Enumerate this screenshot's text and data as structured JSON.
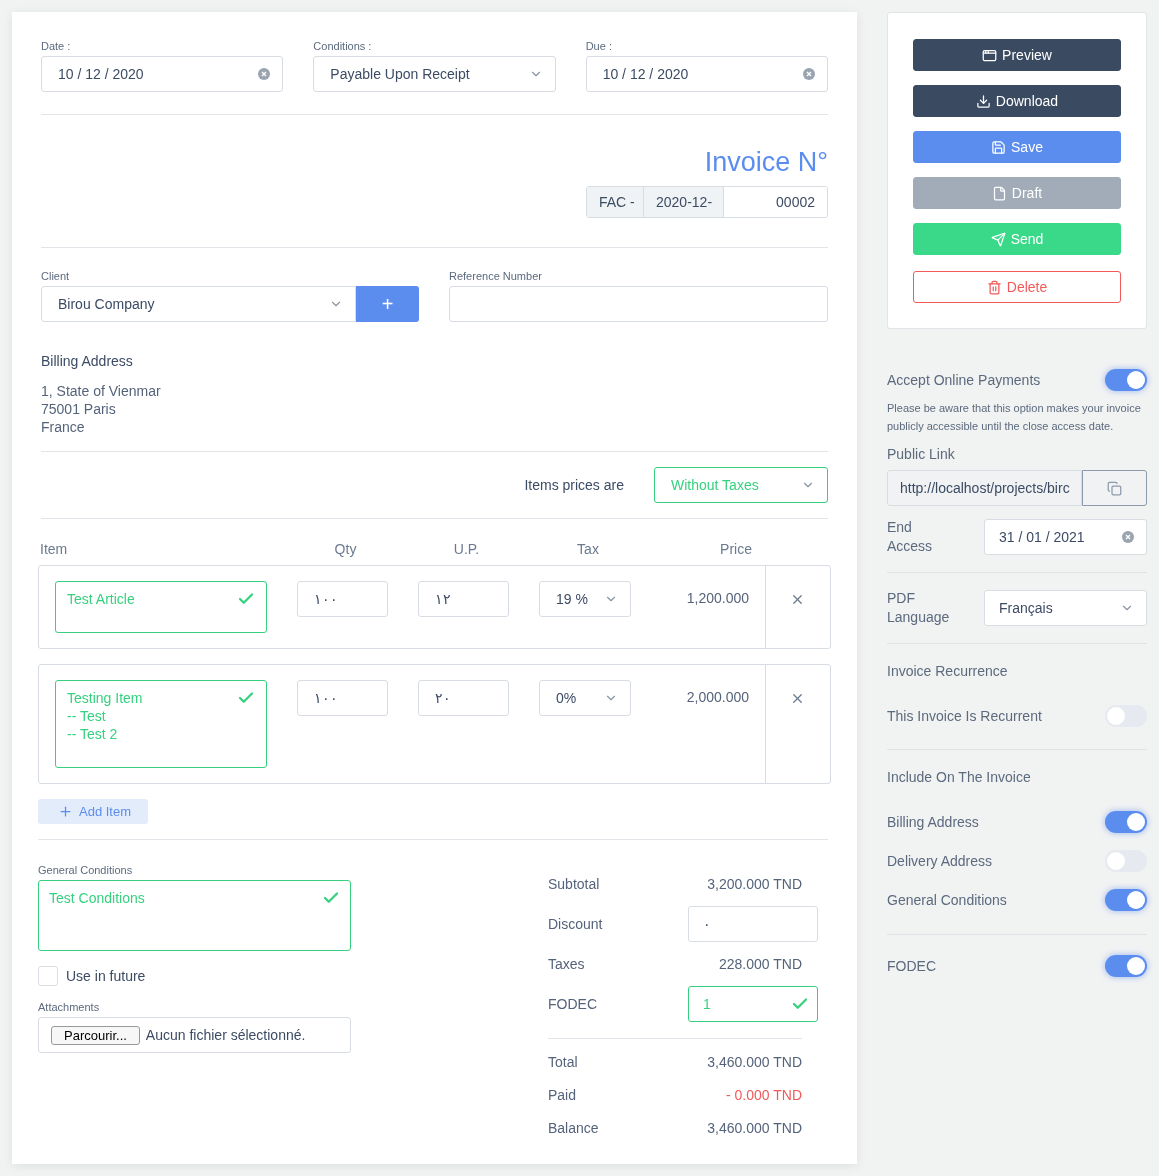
{
  "header_fields": [
    {
      "label": "Date :",
      "value": "10 / 12 / 2020",
      "kind": "date"
    },
    {
      "label": "Conditions :",
      "value": "Payable Upon Receipt",
      "kind": "select"
    },
    {
      "label": "Due :",
      "value": "10 / 12 / 2020",
      "kind": "date"
    }
  ],
  "invoice_number": {
    "title": "Invoice N°",
    "prefix": "FAC -",
    "period": "2020-12-",
    "number": "00002"
  },
  "client": {
    "label": "Client",
    "value": "Birou Company",
    "add_button": "+"
  },
  "reference": {
    "label": "Reference Number"
  },
  "billing_address": {
    "title": "Billing Address",
    "lines": [
      "1, State of Vienmar",
      "75001 Paris",
      "France"
    ]
  },
  "prices": {
    "label": "Items prices are",
    "value": "Without Taxes"
  },
  "columns": [
    "Item",
    "Qty",
    "U.P.",
    "Tax",
    "Price"
  ],
  "items": [
    {
      "lines": [
        "Test Article"
      ],
      "valid": true,
      "qty": "١٠٠",
      "unit_price": "١٢",
      "tax": "19 %",
      "price": "1,200.000"
    },
    {
      "lines": [
        "Testing Item",
        "-- Test",
        "-- Test 2"
      ],
      "valid": true,
      "qty": "١٠٠",
      "unit_price": "٢٠",
      "tax": "0%",
      "price": "2,000.000"
    }
  ],
  "add_item": "Add Item",
  "general_conditions": {
    "label": "General Conditions",
    "value": "Test Conditions",
    "valid": true
  },
  "use_in_future": {
    "label": "Use in future",
    "checked": false
  },
  "attachments": {
    "label": "Attachments",
    "button": "Parcourir...",
    "status": "Aucun fichier sélectionné."
  },
  "totals": [
    {
      "label": "Subtotal",
      "value": "3,200.000 TND",
      "kind": "amount"
    },
    {
      "label": "Discount",
      "value": "٠",
      "kind": "input",
      "valid": false
    },
    {
      "label": "Taxes",
      "value": "228.000 TND",
      "kind": "amount"
    },
    {
      "label": "FODEC",
      "value": "1",
      "kind": "input",
      "valid": true
    }
  ],
  "summary": [
    {
      "label": "Total",
      "value": "3,460.000 TND",
      "kind": "amount"
    },
    {
      "label": "Paid",
      "value": "- 0.000 TND",
      "kind": "deduction"
    },
    {
      "label": "Balance",
      "value": "3,460.000 TND",
      "kind": "amount"
    }
  ],
  "actions": [
    {
      "label": "Preview",
      "kind": "preview"
    },
    {
      "label": "Download",
      "kind": "download"
    },
    {
      "label": "Save",
      "kind": "save"
    },
    {
      "label": "Draft",
      "kind": "draft"
    },
    {
      "label": "Send",
      "kind": "send"
    },
    {
      "label": "Delete",
      "kind": "delete"
    }
  ],
  "online_payments": {
    "label": "Accept Online Payments",
    "on": true,
    "note": "Please be aware that this option makes your invoice publicly accessible until the close access date.",
    "public_link": {
      "label": "Public Link",
      "value": "http://localhost/projects/birc"
    },
    "end_access": {
      "label": "End Access",
      "value": "31 / 01 / 2021"
    }
  },
  "pdf_language": {
    "label": "PDF Language",
    "value": "Français"
  },
  "recurrence": {
    "title": "Invoice Recurrence",
    "label": "This Invoice Is Recurrent",
    "on": false
  },
  "include": {
    "title": "Include On The Invoice",
    "items": [
      {
        "label": "Billing Address",
        "on": true
      },
      {
        "label": "Delivery Address",
        "on": false
      },
      {
        "label": "General Conditions",
        "on": true
      }
    ]
  },
  "fodec": {
    "label": "FODEC",
    "on": true
  }
}
